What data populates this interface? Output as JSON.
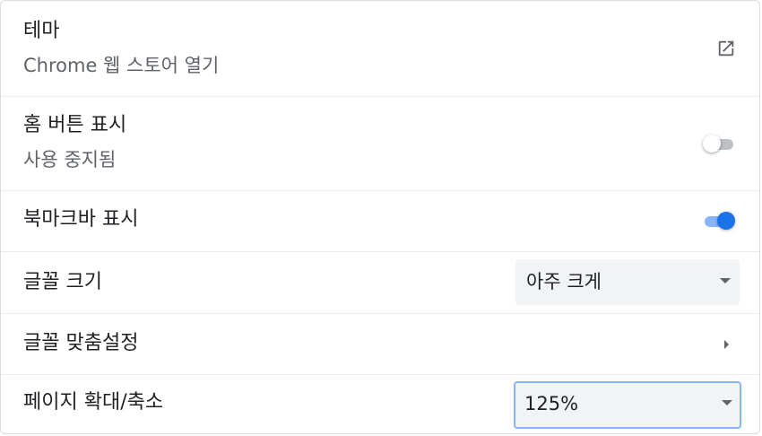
{
  "appearance": {
    "theme": {
      "label": "테마",
      "sublabel": "Chrome 웹 스토어 열기",
      "icon": "open-in-new-icon"
    },
    "home_button": {
      "label": "홈 버튼 표시",
      "sublabel": "사용 중지됨",
      "enabled": false
    },
    "bookmarks_bar": {
      "label": "북마크바 표시",
      "enabled": true
    },
    "font_size": {
      "label": "글꼴 크기",
      "selected": "아주 크게"
    },
    "customize_fonts": {
      "label": "글꼴 맞춤설정",
      "icon": "arrow-right-icon"
    },
    "page_zoom": {
      "label": "페이지 확대/축소",
      "selected": "125%"
    }
  },
  "colors": {
    "accent": "#1a73e8",
    "accent_light": "#8ab4f8",
    "toggle_off": "#bdc1c6",
    "select_bg": "#f1f3f4",
    "divider": "#e8eaed"
  }
}
